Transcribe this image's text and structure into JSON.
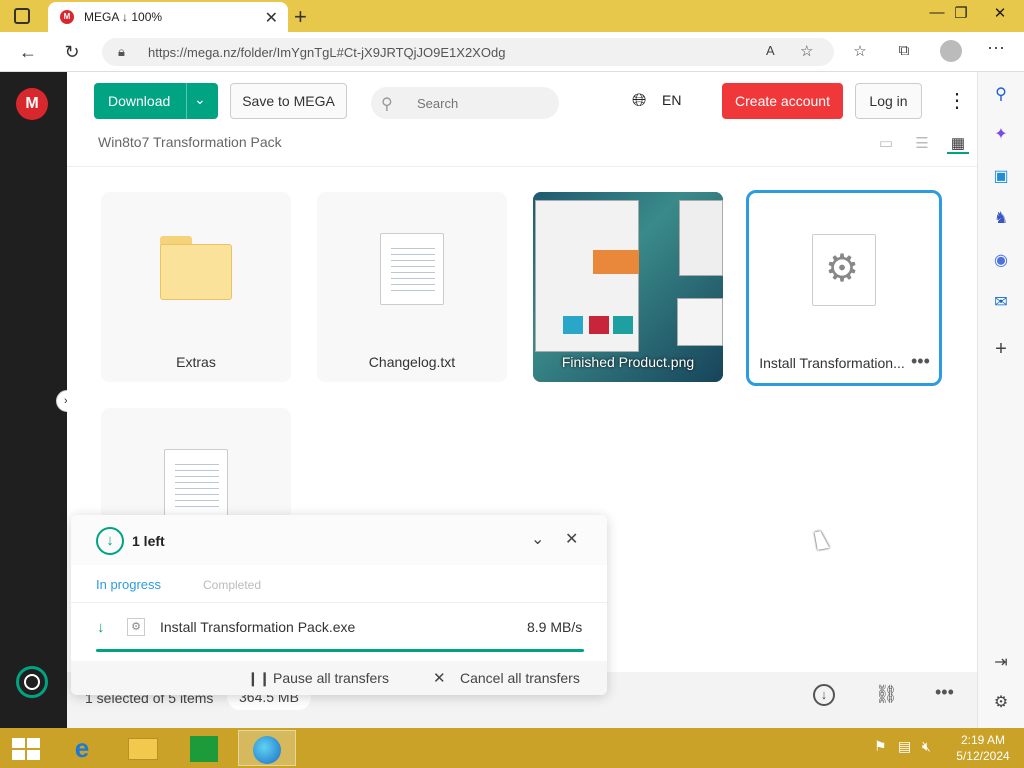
{
  "browser": {
    "tab_title": "MEGA ↓ 100%",
    "url": "https://mega.nz/folder/ImYgnTgL#Ct-jX9JRTQjJO9E1X2XOdg"
  },
  "toolbar": {
    "download_label": "Download",
    "save_label": "Save to MEGA",
    "search_placeholder": "Search",
    "language": "EN",
    "create_account_label": "Create account",
    "login_label": "Log in"
  },
  "breadcrumb": "Win8to7 Transformation Pack",
  "files": [
    {
      "name": "Extras",
      "type": "folder"
    },
    {
      "name": "Changelog.txt",
      "type": "text"
    },
    {
      "name": "Finished Product.png",
      "type": "image"
    },
    {
      "name": "Install Transformation...",
      "type": "exe",
      "selected": true
    },
    {
      "name": "",
      "type": "text"
    }
  ],
  "transfers": {
    "title": "1 left",
    "tab_in_progress": "In progress",
    "tab_completed": "Completed",
    "item_name": "Install Transformation Pack.exe",
    "item_speed": "8.9 MB/s",
    "progress": 1.0,
    "pause_label": "Pause all transfers",
    "cancel_label": "Cancel all transfers"
  },
  "status": {
    "selection": "1 selected of 5 items",
    "size": "364.5 MB"
  },
  "clock": {
    "time": "2:19 AM",
    "date": "5/12/2024"
  },
  "colors": {
    "mega_green": "#00a382",
    "mega_red": "#d9272e",
    "create_red": "#f0373a",
    "selected_border": "#2d9be0"
  }
}
